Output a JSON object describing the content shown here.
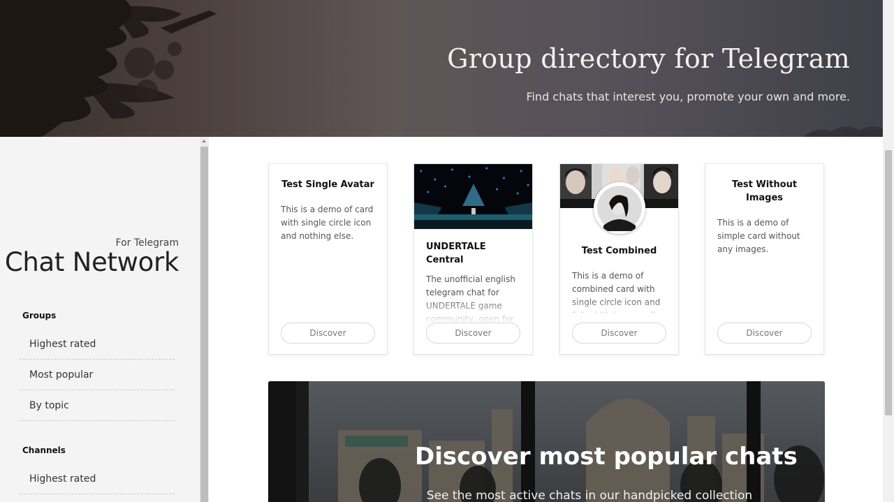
{
  "hero": {
    "title": "Group directory for Telegram",
    "subtitle": "Find chats that interest you, promote your own and more."
  },
  "sidebar": {
    "brand_small": "For Telegram",
    "brand_name": "Chat Network",
    "groups_title": "Groups",
    "groups_items": [
      "Highest rated",
      "Most popular",
      "By topic"
    ],
    "channels_title": "Channels",
    "channels_items": [
      "Highest rated"
    ]
  },
  "cards": [
    {
      "title": "Test Single Avatar",
      "description": "This is a demo of card with single circle icon and nothing else.",
      "button": "Discover"
    },
    {
      "title": "UNDERTALE Central",
      "description": "The unofficial english telegram chat for UNDERTALE game community, open for everyone who follows",
      "button": "Discover"
    },
    {
      "title": "Test Combined",
      "description": "This is a demo of combined card with single circle icon and full width bg as well.",
      "button": "Discover"
    },
    {
      "title": "Test Without Images",
      "description": "This is a demo of simple card without any images.",
      "button": "Discover"
    }
  ],
  "promo": {
    "title": "Discover most popular chats",
    "subtitle": "See the most active chats in our handpicked collection"
  },
  "colors": {
    "hero_gradient_left": "#3a302d",
    "hero_gradient_right": "#3f4049",
    "sidebar_bg": "#f4f4f4",
    "card_border": "#e6e6e6",
    "button_border": "#d7d7d7"
  }
}
